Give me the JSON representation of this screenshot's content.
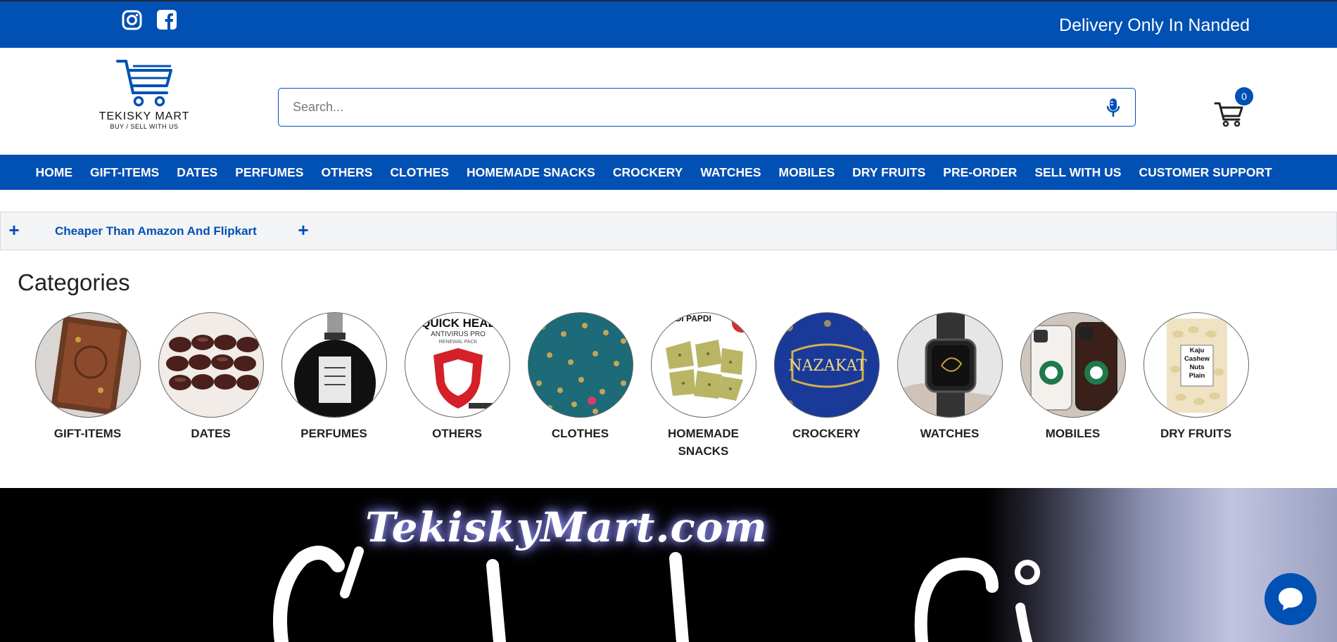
{
  "topbar": {
    "delivery_text": "Delivery Only In Nanded",
    "bg_color": "#0150b4"
  },
  "logo": {
    "name": "TEKISKY MART",
    "tagline": "BUY / SELL WITH US"
  },
  "search": {
    "placeholder": "Search..."
  },
  "cart": {
    "count": "0"
  },
  "nav": {
    "items": [
      "HOME",
      "GIFT-ITEMS",
      "DATES",
      "PERFUMES",
      "OTHERS",
      "CLOTHES",
      "HOMEMADE SNACKS",
      "CROCKERY",
      "WATCHES",
      "MOBILES",
      "DRY FRUITS",
      "PRE-ORDER",
      "SELL WITH US",
      "CUSTOMER SUPPORT"
    ]
  },
  "promo": {
    "text": "Cheaper Than Amazon And Flipkart"
  },
  "categories": {
    "title": "Categories",
    "items": [
      {
        "label": "GIFT-ITEMS"
      },
      {
        "label": "DATES"
      },
      {
        "label": "PERFUMES"
      },
      {
        "label": "OTHERS"
      },
      {
        "label": "CLOTHES"
      },
      {
        "label": "HOMEMADE SNACKS"
      },
      {
        "label": "CROCKERY"
      },
      {
        "label": "WATCHES"
      },
      {
        "label": "MOBILES"
      },
      {
        "label": "DRY FRUITS"
      }
    ],
    "image_text": {
      "others_line1": "QUICK HEAL",
      "others_line2": "ANTIVIRUS PRO",
      "others_line3": "RENEWAL PACK",
      "snacks": "NDI PAPDI",
      "crockery": "NAZAKAT",
      "dryfruits": "Kaju Cashew Nuts Plain"
    }
  },
  "banner": {
    "title": "TekiskyMart.com"
  }
}
